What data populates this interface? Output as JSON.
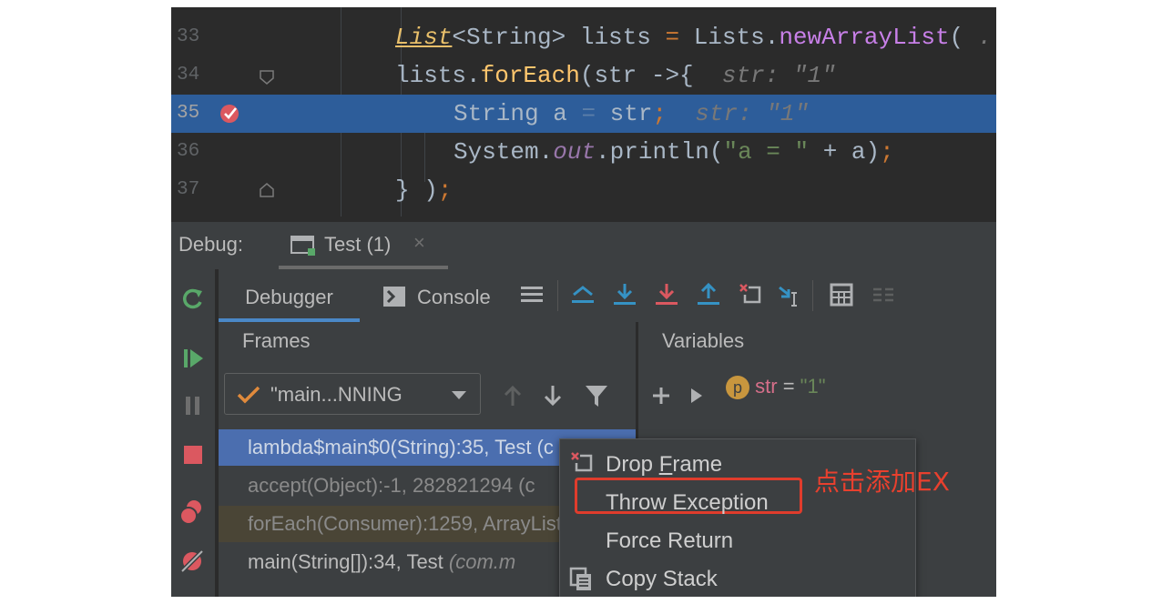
{
  "editor": {
    "lines": [
      {
        "num": "33",
        "parts": [
          [
            "List",
            "type"
          ],
          [
            "<String> lists ",
            "plain"
          ],
          [
            "= ",
            "op"
          ],
          [
            "Lists.",
            "plain"
          ],
          [
            "newArrayList",
            "purple"
          ],
          [
            "( ",
            "plain"
          ],
          [
            ". ",
            "hint"
          ]
        ]
      },
      {
        "num": "34",
        "parts": [
          [
            "lists.",
            "plain"
          ],
          [
            "forEach",
            "method"
          ],
          [
            "(str ->{ ",
            "plain"
          ],
          [
            " str: \"1\"",
            "hint"
          ]
        ]
      },
      {
        "num": "35",
        "parts": [
          [
            "String a ",
            "plain"
          ],
          [
            "= ",
            "dim-eq"
          ],
          [
            "str",
            "plain"
          ],
          [
            "; ",
            "op"
          ],
          [
            " str: \"1\"",
            "hint"
          ]
        ]
      },
      {
        "num": "36",
        "parts": [
          [
            "System.",
            "plain"
          ],
          [
            "out",
            "fld"
          ],
          [
            ".println(",
            "plain"
          ],
          [
            "\"a = \"",
            "str"
          ],
          [
            " + a)",
            "plain"
          ],
          [
            ";",
            "op"
          ]
        ]
      },
      {
        "num": "37",
        "parts": [
          [
            "} )",
            "plain"
          ],
          [
            ";",
            "op"
          ]
        ]
      }
    ]
  },
  "debug": {
    "label": "Debug:",
    "tab": "Test (1)",
    "tab_close": "×"
  },
  "toolbar": {
    "debugger": "Debugger",
    "console": "Console"
  },
  "frames": {
    "title": "Frames",
    "thread": "\"main...NNING",
    "rows": [
      {
        "text": "lambda$main$0(String):35, Test (c"
      },
      {
        "text": "accept(Object):-1, 282821294 (c"
      },
      {
        "text": "forEach(Consumer):1259, ArrayList"
      },
      {
        "text": "main(String[]):34, Test ",
        "extra": "(com.m"
      }
    ]
  },
  "variables": {
    "title": "Variables",
    "badge": "p",
    "name": "str",
    "eq": " = ",
    "value": "\"1\""
  },
  "context_menu": {
    "items": [
      {
        "pre": "Drop ",
        "u": "F",
        "post": "rame"
      },
      {
        "pre": "Throw Exception",
        "u": "",
        "post": ""
      },
      {
        "pre": "Force Return",
        "u": "",
        "post": ""
      },
      {
        "pre": "Copy Stack",
        "u": "",
        "post": ""
      }
    ]
  },
  "annotation": "点击添加EX",
  "colors": {
    "accent": "#4a88c7",
    "highlight_box": "#e03c2c",
    "selected_line": "#2d5d9a"
  }
}
